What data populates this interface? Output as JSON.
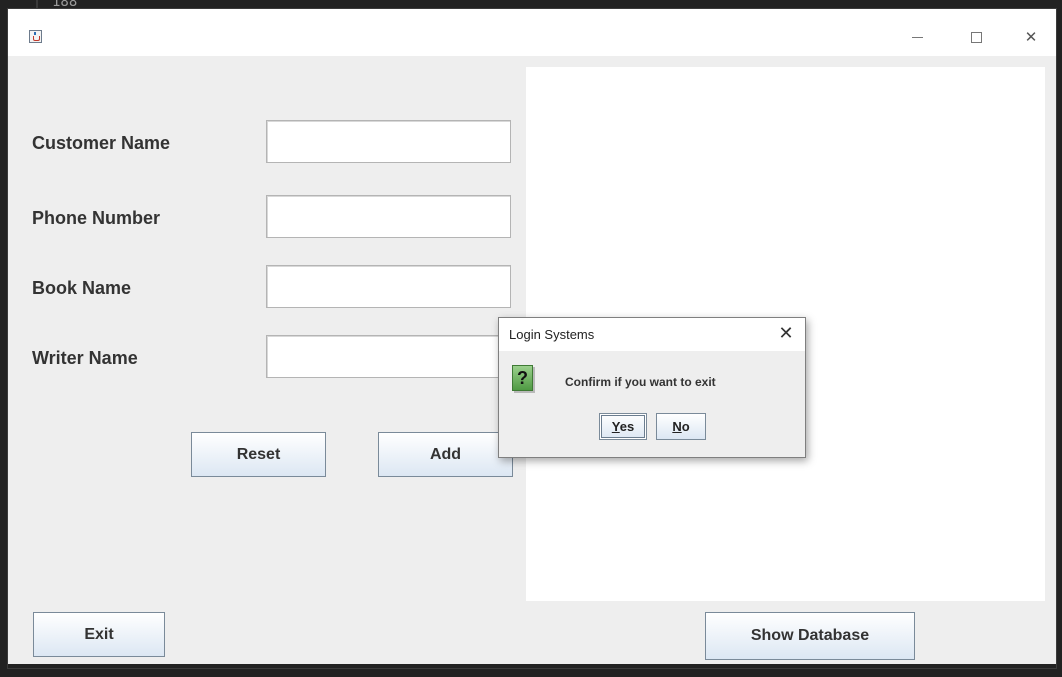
{
  "background": {
    "line_number": "188"
  },
  "window": {
    "controls": {
      "minimize": "minimize",
      "maximize": "maximize",
      "close": "close"
    }
  },
  "form": {
    "customer_name_label": "Customer Name",
    "customer_name_value": "",
    "phone_number_label": "Phone Number",
    "phone_number_value": "",
    "book_name_label": "Book Name",
    "book_name_value": "",
    "writer_name_label": "Writer Name",
    "writer_name_value": "",
    "reset_label": "Reset",
    "add_label": "Add"
  },
  "footer": {
    "exit_label": "Exit",
    "show_database_label": "Show Database"
  },
  "dialog": {
    "title": "Login Systems",
    "message": "Confirm if you want to exit",
    "yes_mnemonic": "Y",
    "yes_rest": "es",
    "no_mnemonic": "N",
    "no_rest": "o",
    "icon": "question-icon"
  },
  "colors": {
    "button_border": "#7a8a99",
    "button_gradient_end": "#dce7f3",
    "panel_background": "#eeeeee",
    "icon_green": "#4f9a43"
  }
}
